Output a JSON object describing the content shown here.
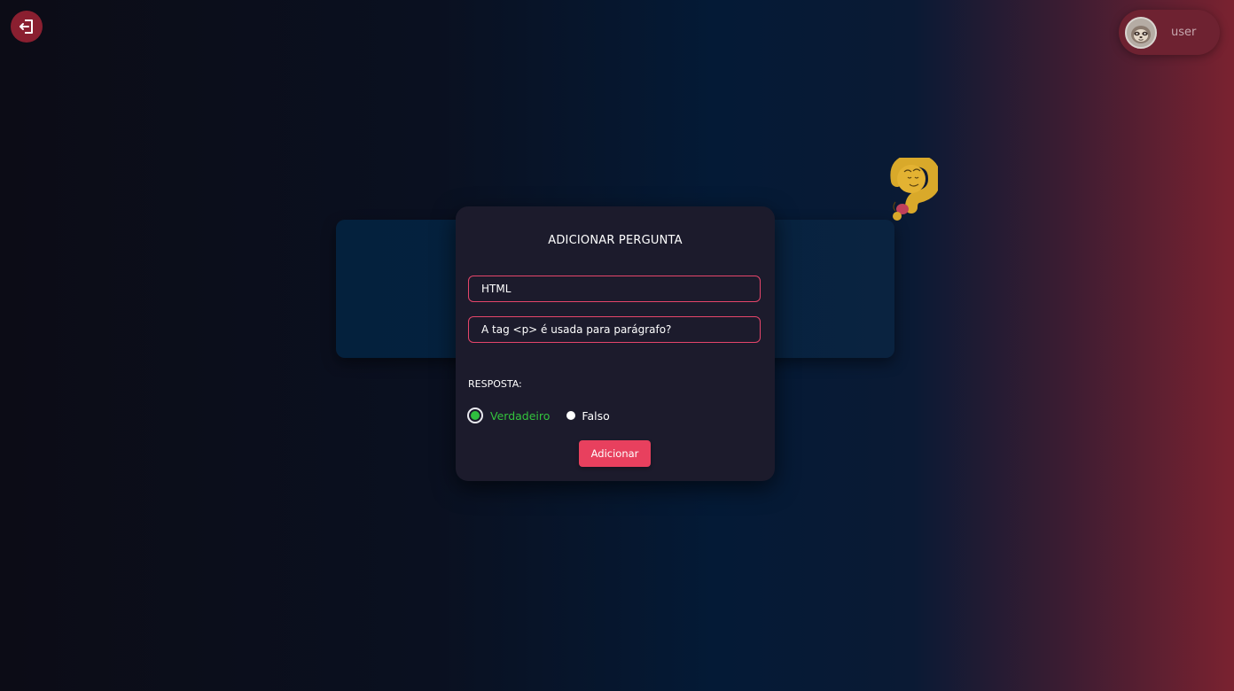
{
  "header": {
    "logout_icon": "logout-icon",
    "user": {
      "name": "user",
      "avatar_icon": "sloth-avatar-icon"
    }
  },
  "modal": {
    "title": "ADICIONAR PERGUNTA",
    "fields": {
      "topic": {
        "value": "HTML"
      },
      "question": {
        "value": "A tag <p> é usada para parágrafo?"
      }
    },
    "answer_label": "RESPOSTA:",
    "options": [
      {
        "label": "Verdadeiro",
        "selected": true
      },
      {
        "label": "Falso",
        "selected": false
      }
    ],
    "submit_label": "Adicionar"
  },
  "colors": {
    "accent": "#e8405e",
    "selected": "#33c43d",
    "modal_bg": "#1c1b2c",
    "user_pill": "#6e2231"
  },
  "decor": {
    "mascot_icon": "question-mark-mascot-icon"
  }
}
